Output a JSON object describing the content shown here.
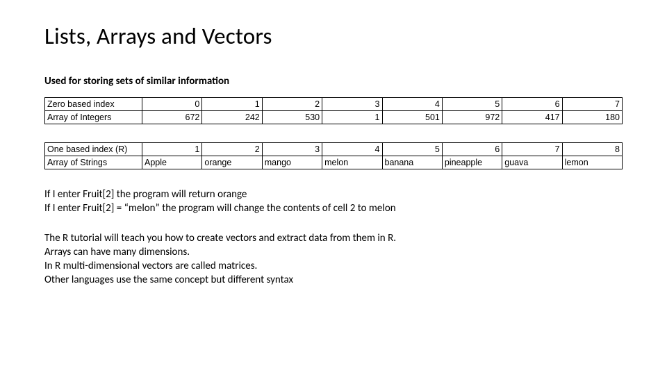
{
  "title": "Lists, Arrays and Vectors",
  "subtitle": "Used for storing sets of similar information",
  "table1": {
    "row1_label": "Zero based index",
    "row1": [
      "0",
      "1",
      "2",
      "3",
      "4",
      "5",
      "6",
      "7"
    ],
    "row2_label": "Array of Integers",
    "row2": [
      "672",
      "242",
      "530",
      "1",
      "501",
      "972",
      "417",
      "180"
    ]
  },
  "table2": {
    "row1_label": "One based index (R)",
    "row1": [
      "1",
      "2",
      "3",
      "4",
      "5",
      "6",
      "7",
      "8"
    ],
    "row2_label": "Array of Strings",
    "row2": [
      "Apple",
      "orange",
      "mango",
      "melon",
      "banana",
      "pineapple",
      "guava",
      "lemon"
    ]
  },
  "para1_line1": "If I enter Fruit[2] the program will return orange",
  "para1_line2": "If I enter Fruit[2] = “melon” the program will change the contents of cell 2 to melon",
  "para2_line1": "The R tutorial will  teach you how to create vectors and extract data from them in R.",
  "para2_line2": "Arrays can have many dimensions.",
  "para2_line3": "In R multi-dimensional vectors are called matrices.",
  "para2_line4": "Other languages use the same concept but different syntax",
  "chart_data": [
    {
      "type": "table",
      "title": "Zero based index / Array of Integers",
      "columns": [
        "0",
        "1",
        "2",
        "3",
        "4",
        "5",
        "6",
        "7"
      ],
      "rows": [
        {
          "label": "Array of Integers",
          "values": [
            672,
            242,
            530,
            1,
            501,
            972,
            417,
            180
          ]
        }
      ]
    },
    {
      "type": "table",
      "title": "One based index (R) / Array of Strings",
      "columns": [
        "1",
        "2",
        "3",
        "4",
        "5",
        "6",
        "7",
        "8"
      ],
      "rows": [
        {
          "label": "Array of Strings",
          "values": [
            "Apple",
            "orange",
            "mango",
            "melon",
            "banana",
            "pineapple",
            "guava",
            "lemon"
          ]
        }
      ]
    }
  ]
}
